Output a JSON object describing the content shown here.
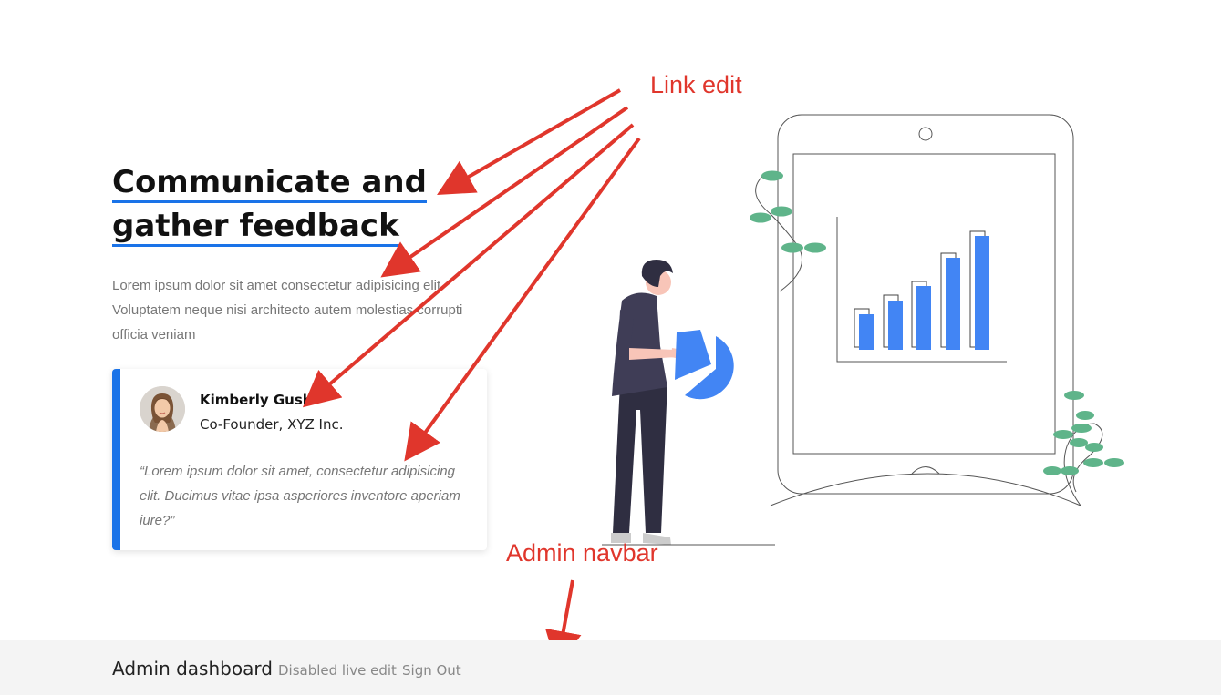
{
  "hero": {
    "title_line1": "Communicate and",
    "title_line2": "gather feedback",
    "lead": "Lorem ipsum dolor sit amet consectetur adipisicing elit. Voluptatem neque nisi architecto autem molestias corrupti officia veniam"
  },
  "testimonial": {
    "name": "Kimberly Gush",
    "role": "Co-Founder, XYZ Inc.",
    "quote": "“Lorem ipsum dolor sit amet, consectetur adipisicing elit. Ducimus vitae ipsa asperiores inventore aperiam iure?”",
    "avatar_icon": "avatar-photo"
  },
  "annotations": {
    "link_edit": "Link edit",
    "admin_navbar": "Admin navbar",
    "color": "#e0362c"
  },
  "admin_bar": {
    "brand": "Admin dashboard",
    "live_edit": "Disabled live edit",
    "sign_out": "Sign Out"
  },
  "colors": {
    "accent": "#1a73e8",
    "chart_blue": "#4285f4",
    "leaf_green": "#5fb48a"
  }
}
